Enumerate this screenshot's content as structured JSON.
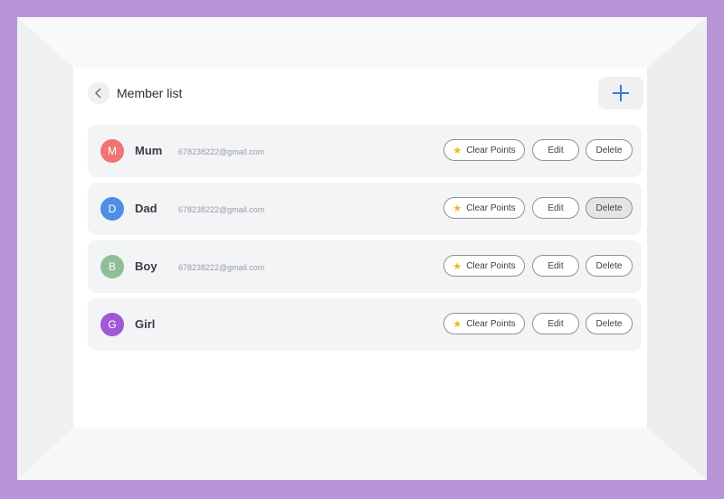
{
  "header": {
    "title": "Member list",
    "back_icon": "chevron-left-icon",
    "add_icon": "plus-icon"
  },
  "members": [
    {
      "initial": "M",
      "name": "Mum",
      "email": "678238222@gmail.com",
      "color": "#f07474"
    },
    {
      "initial": "D",
      "name": "Dad",
      "email": "678238222@gmail.com",
      "color": "#4e8fe6"
    },
    {
      "initial": "B",
      "name": "Boy",
      "email": "678238222@gmail.com",
      "color": "#8fbf98"
    },
    {
      "initial": "G",
      "name": "Girl",
      "email": "",
      "color": "#a059d6"
    }
  ],
  "actions": {
    "clear_points": "Clear Points",
    "edit": "Edit",
    "delete": "Delete",
    "star_icon": "star-icon"
  },
  "colors": {
    "frame": "#b995d8",
    "accent": "#3f77d8",
    "star": "#f2b516"
  }
}
